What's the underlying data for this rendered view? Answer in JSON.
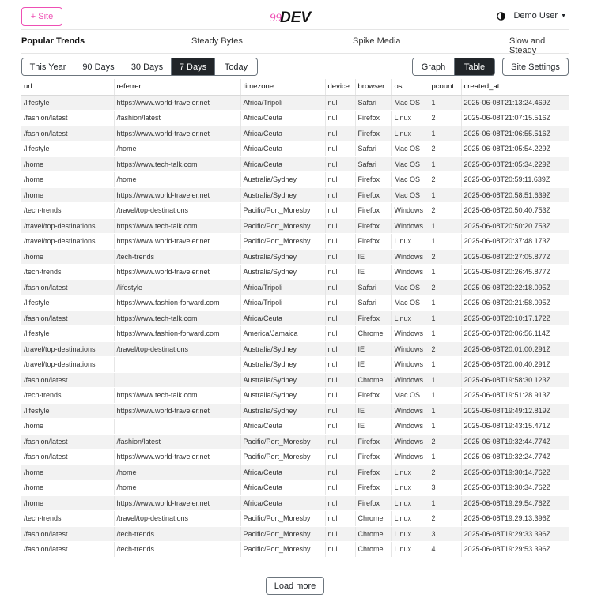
{
  "header": {
    "add_site_label": "+ Site",
    "logo_text_prefix": "99",
    "logo_text_suffix": "DEV",
    "user_label": "Demo User"
  },
  "tabs": [
    "Popular Trends",
    "Steady Bytes",
    "Spike Media",
    "Slow and Steady"
  ],
  "ranges": [
    "This Year",
    "90 Days",
    "30 Days",
    "7 Days",
    "Today"
  ],
  "views": [
    "Graph",
    "Table"
  ],
  "settings_label": "Site Settings",
  "load_more_label": "Load more",
  "colors": {
    "accent": "#ee4fb4",
    "dark": "#212529"
  },
  "table": {
    "columns": [
      "url",
      "referrer",
      "timezone",
      "device",
      "browser",
      "os",
      "pcount",
      "created_at"
    ],
    "rows": [
      [
        "/lifestyle",
        "https://www.world-traveler.net",
        "Africa/Tripoli",
        "null",
        "Safari",
        "Mac OS",
        "1",
        "2025-06-08T21:13:24.469Z"
      ],
      [
        "/fashion/latest",
        "/fashion/latest",
        "Africa/Ceuta",
        "null",
        "Firefox",
        "Linux",
        "2",
        "2025-06-08T21:07:15.516Z"
      ],
      [
        "/fashion/latest",
        "https://www.world-traveler.net",
        "Africa/Ceuta",
        "null",
        "Firefox",
        "Linux",
        "1",
        "2025-06-08T21:06:55.516Z"
      ],
      [
        "/lifestyle",
        "/home",
        "Africa/Ceuta",
        "null",
        "Safari",
        "Mac OS",
        "2",
        "2025-06-08T21:05:54.229Z"
      ],
      [
        "/home",
        "https://www.tech-talk.com",
        "Africa/Ceuta",
        "null",
        "Safari",
        "Mac OS",
        "1",
        "2025-06-08T21:05:34.229Z"
      ],
      [
        "/home",
        "/home",
        "Australia/Sydney",
        "null",
        "Firefox",
        "Mac OS",
        "2",
        "2025-06-08T20:59:11.639Z"
      ],
      [
        "/home",
        "https://www.world-traveler.net",
        "Australia/Sydney",
        "null",
        "Firefox",
        "Mac OS",
        "1",
        "2025-06-08T20:58:51.639Z"
      ],
      [
        "/tech-trends",
        "/travel/top-destinations",
        "Pacific/Port_Moresby",
        "null",
        "Firefox",
        "Windows",
        "2",
        "2025-06-08T20:50:40.753Z"
      ],
      [
        "/travel/top-destinations",
        "https://www.tech-talk.com",
        "Pacific/Port_Moresby",
        "null",
        "Firefox",
        "Windows",
        "1",
        "2025-06-08T20:50:20.753Z"
      ],
      [
        "/travel/top-destinations",
        "https://www.world-traveler.net",
        "Pacific/Port_Moresby",
        "null",
        "Firefox",
        "Linux",
        "1",
        "2025-06-08T20:37:48.173Z"
      ],
      [
        "/home",
        "/tech-trends",
        "Australia/Sydney",
        "null",
        "IE",
        "Windows",
        "2",
        "2025-06-08T20:27:05.877Z"
      ],
      [
        "/tech-trends",
        "https://www.world-traveler.net",
        "Australia/Sydney",
        "null",
        "IE",
        "Windows",
        "1",
        "2025-06-08T20:26:45.877Z"
      ],
      [
        "/fashion/latest",
        "/lifestyle",
        "Africa/Tripoli",
        "null",
        "Safari",
        "Mac OS",
        "2",
        "2025-06-08T20:22:18.095Z"
      ],
      [
        "/lifestyle",
        "https://www.fashion-forward.com",
        "Africa/Tripoli",
        "null",
        "Safari",
        "Mac OS",
        "1",
        "2025-06-08T20:21:58.095Z"
      ],
      [
        "/fashion/latest",
        "https://www.tech-talk.com",
        "Africa/Ceuta",
        "null",
        "Firefox",
        "Linux",
        "1",
        "2025-06-08T20:10:17.172Z"
      ],
      [
        "/lifestyle",
        "https://www.fashion-forward.com",
        "America/Jamaica",
        "null",
        "Chrome",
        "Windows",
        "1",
        "2025-06-08T20:06:56.114Z"
      ],
      [
        "/travel/top-destinations",
        "/travel/top-destinations",
        "Australia/Sydney",
        "null",
        "IE",
        "Windows",
        "2",
        "2025-06-08T20:01:00.291Z"
      ],
      [
        "/travel/top-destinations",
        "",
        "Australia/Sydney",
        "null",
        "IE",
        "Windows",
        "1",
        "2025-06-08T20:00:40.291Z"
      ],
      [
        "/fashion/latest",
        "",
        "Australia/Sydney",
        "null",
        "Chrome",
        "Windows",
        "1",
        "2025-06-08T19:58:30.123Z"
      ],
      [
        "/tech-trends",
        "https://www.tech-talk.com",
        "Australia/Sydney",
        "null",
        "Firefox",
        "Mac OS",
        "1",
        "2025-06-08T19:51:28.913Z"
      ],
      [
        "/lifestyle",
        "https://www.world-traveler.net",
        "Australia/Sydney",
        "null",
        "IE",
        "Windows",
        "1",
        "2025-06-08T19:49:12.819Z"
      ],
      [
        "/home",
        "",
        "Africa/Ceuta",
        "null",
        "IE",
        "Windows",
        "1",
        "2025-06-08T19:43:15.471Z"
      ],
      [
        "/fashion/latest",
        "/fashion/latest",
        "Pacific/Port_Moresby",
        "null",
        "Firefox",
        "Windows",
        "2",
        "2025-06-08T19:32:44.774Z"
      ],
      [
        "/fashion/latest",
        "https://www.world-traveler.net",
        "Pacific/Port_Moresby",
        "null",
        "Firefox",
        "Windows",
        "1",
        "2025-06-08T19:32:24.774Z"
      ],
      [
        "/home",
        "/home",
        "Africa/Ceuta",
        "null",
        "Firefox",
        "Linux",
        "2",
        "2025-06-08T19:30:14.762Z"
      ],
      [
        "/home",
        "/home",
        "Africa/Ceuta",
        "null",
        "Firefox",
        "Linux",
        "3",
        "2025-06-08T19:30:34.762Z"
      ],
      [
        "/home",
        "https://www.world-traveler.net",
        "Africa/Ceuta",
        "null",
        "Firefox",
        "Linux",
        "1",
        "2025-06-08T19:29:54.762Z"
      ],
      [
        "/tech-trends",
        "/travel/top-destinations",
        "Pacific/Port_Moresby",
        "null",
        "Chrome",
        "Linux",
        "2",
        "2025-06-08T19:29:13.396Z"
      ],
      [
        "/fashion/latest",
        "/tech-trends",
        "Pacific/Port_Moresby",
        "null",
        "Chrome",
        "Linux",
        "3",
        "2025-06-08T19:29:33.396Z"
      ],
      [
        "/fashion/latest",
        "/tech-trends",
        "Pacific/Port_Moresby",
        "null",
        "Chrome",
        "Linux",
        "4",
        "2025-06-08T19:29:53.396Z"
      ]
    ]
  }
}
